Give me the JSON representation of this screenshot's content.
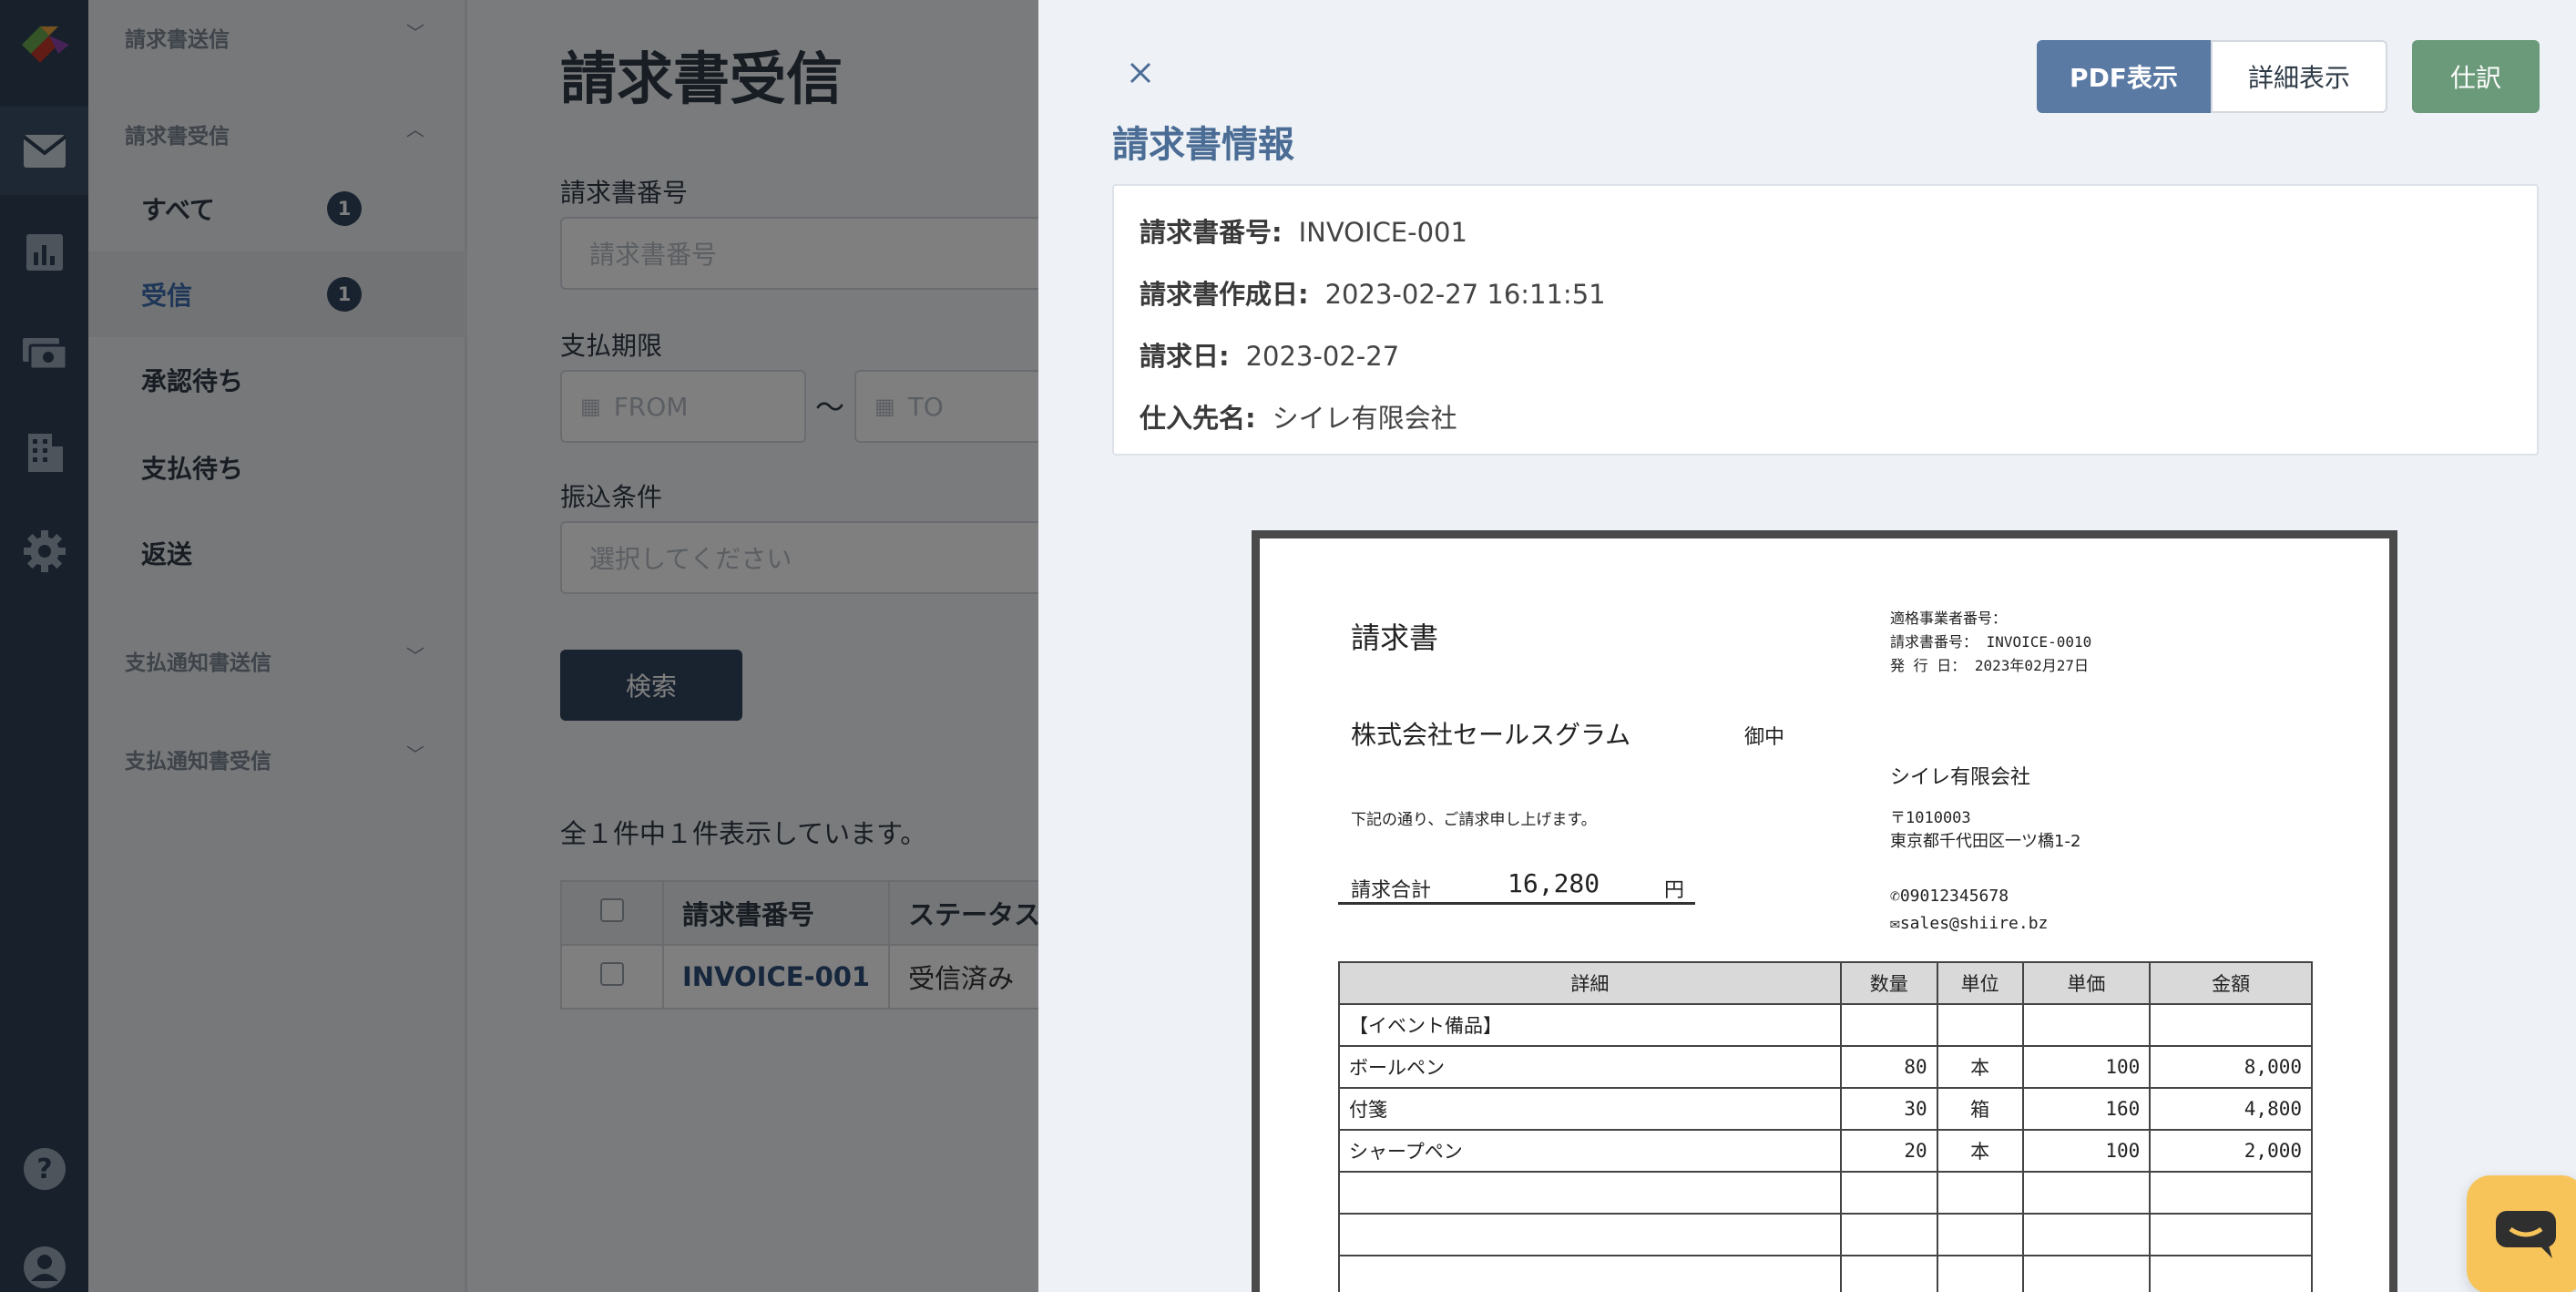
{
  "sidebar_nav": {
    "group_send": "請求書送信",
    "group_receive": "請求書受信",
    "items": [
      {
        "label": "すべて",
        "badge": "1"
      },
      {
        "label": "受信",
        "badge": "1"
      },
      {
        "label": "承認待ち"
      },
      {
        "label": "支払待ち"
      },
      {
        "label": "返送"
      }
    ],
    "group_payment_send": "支払通知書送信",
    "group_payment_receive": "支払通知書受信"
  },
  "main": {
    "title": "請求書受信",
    "invoice_number_label": "請求書番号",
    "invoice_number_placeholder": "請求書番号",
    "due_label": "支払期限",
    "from_placeholder": "FROM",
    "range_sep": "〜",
    "to_placeholder": "TO",
    "transfer_label": "振込条件",
    "transfer_placeholder": "選択してください",
    "search_button": "検索",
    "result_count": "全１件中１件表示しています。",
    "table": {
      "headers": [
        "請求書番号",
        "ステータス"
      ],
      "rows": [
        {
          "invoice": "INVOICE-001",
          "status": "受信済み"
        }
      ]
    }
  },
  "panel": {
    "pdf_button": "PDF表示",
    "detail_button": "詳細表示",
    "shiwake_button": "仕訳",
    "title": "請求書情報",
    "info": [
      {
        "label": "請求書番号:",
        "value": "INVOICE-001"
      },
      {
        "label": "請求書作成日:",
        "value": "2023-02-27 16:11:51"
      },
      {
        "label": "請求日:",
        "value": "2023-02-27"
      },
      {
        "label": "仕入先名:",
        "value": "シイレ有限会社"
      }
    ]
  },
  "invoice_doc": {
    "title": "請求書",
    "qualified_number_label": "適格事業者番号：",
    "invoice_number_line": "請求書番号： INVOICE-0010",
    "issue_date_line": "発 行 日： 2023年02月27日",
    "recipient": "株式会社セールスグラム",
    "honorific": "御中",
    "issuer": "シイレ有限会社",
    "postal": "〒1010003",
    "address": "東京都千代田区一ツ橋1-2",
    "phone": "09012345678",
    "email": "sales@shiire.bz",
    "message": "下記の通り、ご請求申し上げます。",
    "total_label": "請求合計",
    "total_value": "16,280",
    "total_unit": "円",
    "table_headers": [
      "詳細",
      "数量",
      "単位",
      "単価",
      "金額"
    ],
    "lines": [
      {
        "detail": "【イベント備品】",
        "qty": "",
        "unit": "",
        "price": "",
        "amount": ""
      },
      {
        "detail": "ボールペン",
        "qty": "80",
        "unit": "本",
        "price": "100",
        "amount": "8,000"
      },
      {
        "detail": "付箋",
        "qty": "30",
        "unit": "箱",
        "price": "160",
        "amount": "4,800"
      },
      {
        "detail": "シャープペン",
        "qty": "20",
        "unit": "本",
        "price": "100",
        "amount": "2,000"
      },
      {
        "detail": "",
        "qty": "",
        "unit": "",
        "price": "",
        "amount": ""
      },
      {
        "detail": "",
        "qty": "",
        "unit": "",
        "price": "",
        "amount": ""
      },
      {
        "detail": "",
        "qty": "",
        "unit": "",
        "price": "",
        "amount": ""
      }
    ]
  }
}
